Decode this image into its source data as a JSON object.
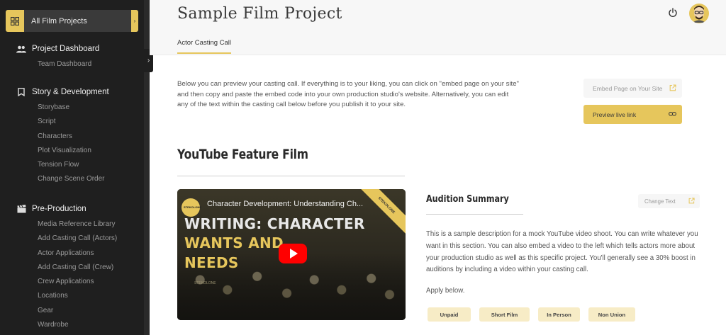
{
  "sidebar": {
    "all_projects_label": "All Film Projects",
    "sections": [
      {
        "header": "Project Dashboard",
        "icon": "people-icon",
        "items": [
          "Team Dashboard"
        ]
      },
      {
        "header": "Story & Development",
        "icon": "bookmark-icon",
        "items": [
          "Storybase",
          "Script",
          "Characters",
          "Plot Visualization",
          "Tension Flow",
          "Change Scene Order"
        ]
      },
      {
        "header": "Pre-Production",
        "icon": "clapperboard-icon",
        "items": [
          "Media Reference Library",
          "Add Casting Call (Actors)",
          "Actor Applications",
          "Add Casting Call (Crew)",
          "Crew Applications",
          "Locations",
          "Gear",
          "Wardrobe"
        ]
      }
    ]
  },
  "header": {
    "title": "Sample Film Project",
    "tab": "Actor Casting Call"
  },
  "intro": {
    "text": "Below you can preview your casting call. If everything is to your liking, you can click on \"embed page on your site\" and then copy and paste the embed code into your own production studio's website. Alternatively, you can edit any of the text within the casting call below before you publish it to your site.",
    "embed_button": "Embed Page on Your Site",
    "preview_button": "Preview live link"
  },
  "film": {
    "title": "YouTube Feature Film"
  },
  "video": {
    "title": "Character Development: Understanding Ch...",
    "channel": "STEKOLONE",
    "line1": "WRITING: CHARACTER",
    "line2": "WANTS AND",
    "line3": "NEEDS",
    "banner": "STEKOLONE",
    "watermark": "STEKOLONE"
  },
  "audition": {
    "title": "Audition Summary",
    "change_button": "Change Text",
    "text": "This is a sample description for a mock YouTube video shoot. You can write whatever you want in this section. You can also embed a video to the left which tells actors more about your production studio as well as this specific project. You'll generally see a 30% boost in auditions by including a video within your casting call.",
    "apply": "Apply below.",
    "tags": [
      "Unpaid",
      "Short Film",
      "In Person",
      "Non Union"
    ]
  },
  "colors": {
    "accent": "#e6c65c",
    "sidebar_bg": "#1f1f1f",
    "tag_bg": "#f7ecc6"
  }
}
